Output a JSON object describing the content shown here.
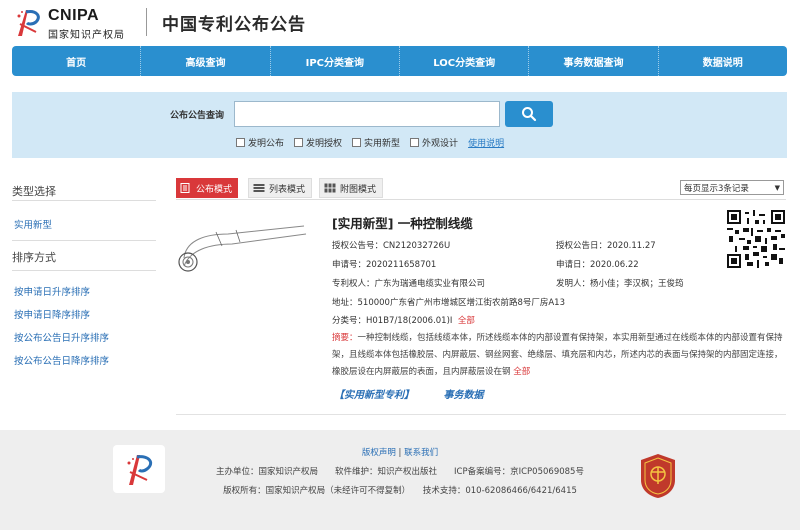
{
  "header": {
    "logo_en": "CNIPA",
    "logo_cn": "国家知识产权局",
    "title": "中国专利公布公告"
  },
  "nav": [
    {
      "label": "首页"
    },
    {
      "label": "高级查询"
    },
    {
      "label": "IPC分类查询"
    },
    {
      "label": "LOC分类查询"
    },
    {
      "label": "事务数据查询"
    },
    {
      "label": "数据说明"
    }
  ],
  "search": {
    "label": "公布公告查询",
    "value": "",
    "placeholder": "",
    "button_icon": "search-icon",
    "checkboxes": [
      {
        "label": "发明公布",
        "checked": false
      },
      {
        "label": "发明授权",
        "checked": false
      },
      {
        "label": "实用新型",
        "checked": false
      },
      {
        "label": "外观设计",
        "checked": false
      }
    ],
    "help": "使用说明"
  },
  "sidebar": {
    "type_heading": "类型选择",
    "type_items": [
      "实用新型"
    ],
    "sort_heading": "排序方式",
    "sort_items": [
      "按申请日升序排序",
      "按申请日降序排序",
      "按公布公告日升序排序",
      "按公布公告日降序排序"
    ]
  },
  "modes": {
    "announce": "公布模式",
    "list": "列表模式",
    "image": "附图模式",
    "per_page": "每页显示3条记录"
  },
  "result": {
    "title": "[实用新型] 一种控制线缆",
    "grant_no": "授权公告号：CN212032726U",
    "grant_date": "授权公告日：2020.11.27",
    "app_no": "申请号：2020211658701",
    "app_date": "申请日：2020.06.22",
    "patentee": "专利权人：广东为瑞通电缆实业有限公司",
    "inventors": "发明人：杨小佳；李汉枫；王俊筠",
    "address": "地址：510000广东省广州市增城区增江街农前路8号厂房A13",
    "class_no": "分类号：H01B7/18(2006.01)I",
    "full": "全部",
    "abstract_label": "摘要：",
    "abstract": "一种控制线缆，包括线缆本体，所述线缆本体的内部设置有保持架，本实用新型通过在线缆本体的内部设置有保持架，且线缆本体包括橡胶层、内屏蔽层、钢丝网套、绝缘层、填充层和内芯，所述内芯的表面与保持架的内部固定连接，橡胶层设在内屏蔽层的表面，且内屏蔽层设在钢",
    "links": [
      "【实用新型专利】",
      "事务数据"
    ]
  },
  "footer": {
    "links": [
      "版权声明",
      "联系我们"
    ],
    "line2": "主办单位：国家知识产权局　　软件维护：知识产权出版社　　ICP备案编号：京ICP05069085号",
    "line3": "版权所有：国家知识产权局（未经许可不得复制）　　技术支持：010-62086466/6421/6415"
  },
  "colors": {
    "nav_blue": "#2a8fcf",
    "search_band": "#d2e8f6",
    "active_tab": "#d9383a",
    "link_blue": "#2a6fb5"
  }
}
